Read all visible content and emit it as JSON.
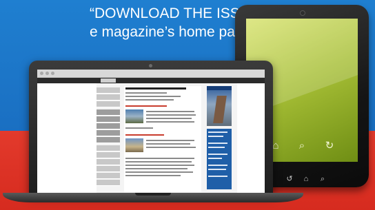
{
  "headline": {
    "line1": "“DOWNLOAD THE ISSUE”",
    "line2": "e magazine’s home page."
  },
  "colors": {
    "top_background": "#1f7fd0",
    "bottom_background": "#e33a2c",
    "tablet_screen": "#a7bf36",
    "site_accent": "#1f5fa8"
  },
  "tablet": {
    "screen_buttons": [
      {
        "icon": "home-icon",
        "glyph": "⌂"
      },
      {
        "icon": "search-icon",
        "glyph": "⌕"
      },
      {
        "icon": "refresh-icon",
        "glyph": "↻"
      }
    ],
    "hardware_buttons": [
      {
        "icon": "back-icon",
        "glyph": "↺"
      },
      {
        "icon": "home-icon",
        "glyph": "⌂"
      },
      {
        "icon": "search-icon",
        "glyph": "⌕"
      }
    ]
  }
}
